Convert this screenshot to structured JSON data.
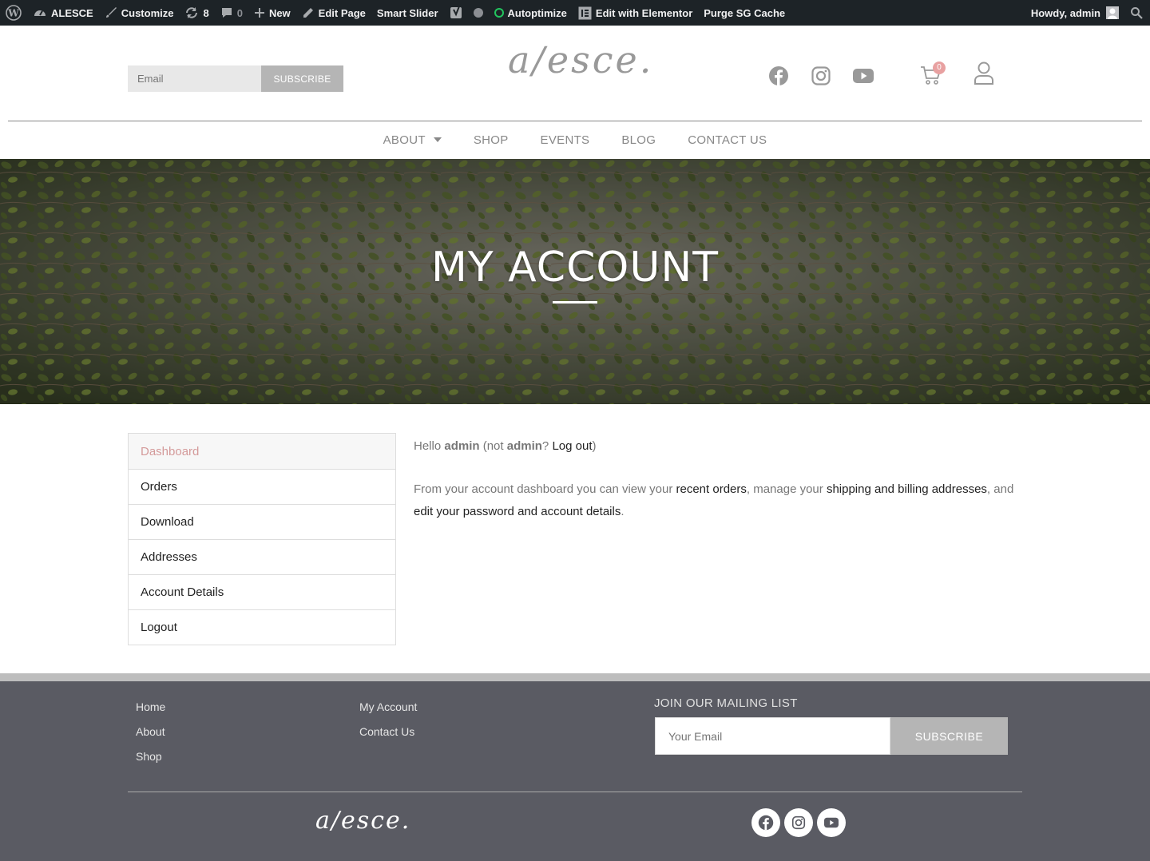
{
  "adminbar": {
    "site_name": "ALESCE",
    "customize": "Customize",
    "updates_count": "8",
    "comments_count": "0",
    "new": "New",
    "edit_page": "Edit Page",
    "smart_slider": "Smart Slider",
    "autoptimize": "Autoptimize",
    "edit_elementor": "Edit with Elementor",
    "purge": "Purge SG Cache",
    "howdy": "Howdy, admin"
  },
  "header": {
    "email_placeholder": "Email",
    "subscribe_label": "SUBSCRIBE",
    "logo_text": "a/esce.",
    "cart_count": "0",
    "social_icons": [
      "facebook-icon",
      "instagram-icon",
      "youtube-icon"
    ]
  },
  "nav": {
    "items": [
      "ABOUT",
      "SHOP",
      "EVENTS",
      "BLOG",
      "CONTACT US"
    ]
  },
  "hero": {
    "title": "MY ACCOUNT"
  },
  "account_nav": {
    "items": [
      "Dashboard",
      "Orders",
      "Download",
      "Addresses",
      "Account Details",
      "Logout"
    ]
  },
  "content": {
    "hello": "Hello ",
    "user": "admin",
    "not_open": " (not ",
    "user2": "admin",
    "q": "? ",
    "logout": "Log out",
    "close": ")",
    "p2_a": "From your account dashboard you can view your ",
    "recent_orders": "recent orders",
    "p2_b": ", manage your ",
    "addresses": "shipping and billing addresses",
    "p2_c": ", and ",
    "edit_pw": "edit your password and account details",
    "p2_d": "."
  },
  "footer": {
    "col1": [
      "Home",
      "About",
      "Shop"
    ],
    "col2": [
      "My Account",
      "Contact Us"
    ],
    "mailing_title": "JOIN OUR MAILING LIST",
    "email_placeholder": "Your Email",
    "subscribe_label": "SUBSCRIBE",
    "logo_text": "a/esce."
  },
  "colors": {
    "admin_bar": "#1d2327",
    "accent_pink": "#d49a9a",
    "footer_bg": "#5a5b63"
  }
}
